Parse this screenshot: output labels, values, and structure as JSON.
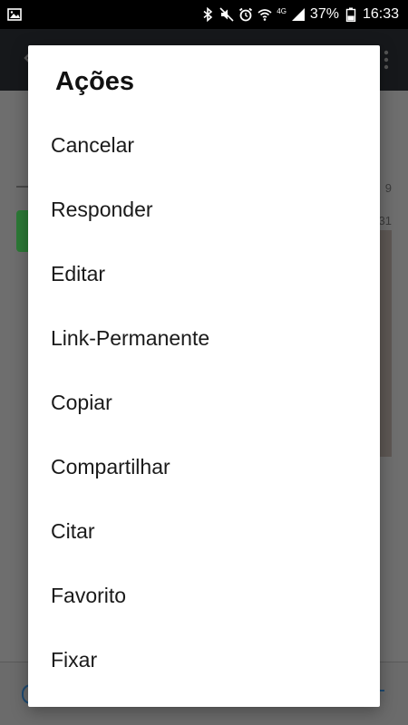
{
  "status_bar": {
    "battery_percent": "37%",
    "time": "16:33",
    "network_type": "4G",
    "icons": [
      "image-notification-icon",
      "bluetooth-icon",
      "mute-icon",
      "alarm-icon",
      "wifi-icon",
      "signal-icon",
      "battery-icon"
    ]
  },
  "background": {
    "numbers": [
      "9",
      "31"
    ]
  },
  "dialog": {
    "title": "Ações",
    "actions": [
      "Cancelar",
      "Responder",
      "Editar",
      "Link-Permanente",
      "Copiar",
      "Compartilhar",
      "Citar",
      "Favorito",
      "Fixar"
    ]
  }
}
